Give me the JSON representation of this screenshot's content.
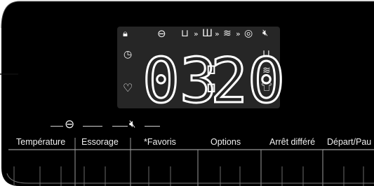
{
  "display": {
    "time_hours": "03",
    "time_separator": ":",
    "time_minutes": "20",
    "top_icons": [
      {
        "name": "child-lock-icon",
        "glyph": "🔒︎"
      },
      {
        "name": "spin-drum-icon",
        "glyph": "⊖"
      },
      {
        "name": "wash-basin-icon",
        "glyph": "⊔"
      },
      {
        "name": "wash-step-icon",
        "glyph": "Ш"
      },
      {
        "name": "rinse-icon",
        "glyph": "≋"
      },
      {
        "name": "spin-icon",
        "glyph": "◎"
      },
      {
        "name": "mute-icon",
        "glyph": "🔇︎"
      }
    ],
    "arrow_glyph": "»",
    "left_icons": [
      {
        "name": "delay-clock-icon",
        "glyph": "◷"
      },
      {
        "name": "favorite-heart-icon",
        "glyph": "♡"
      }
    ],
    "right_icons": [
      {
        "name": "wash-tub-icon",
        "glyph": "⊔"
      },
      {
        "name": "rinse-tub-icon",
        "glyph": "≋"
      },
      {
        "name": "shirt-icon",
        "glyph": "👕︎"
      }
    ]
  },
  "secondary_symbols": {
    "temperature_essorage_icon": "⊖",
    "mute_icon": "🔇︎"
  },
  "buttons": [
    {
      "id": "temperature",
      "label": "Température"
    },
    {
      "id": "essorage",
      "label": "Essorage"
    },
    {
      "id": "favoris",
      "label": "*Favoris"
    },
    {
      "id": "options",
      "label": "Options"
    },
    {
      "id": "arret-differe",
      "label": "Arrêt différé"
    },
    {
      "id": "depart-pause",
      "label": "Départ/Pau"
    }
  ],
  "colors": {
    "panel": "#000000",
    "display_bg": "#262626",
    "text": "#f0f0f0",
    "divider": "#cfcfcf"
  }
}
